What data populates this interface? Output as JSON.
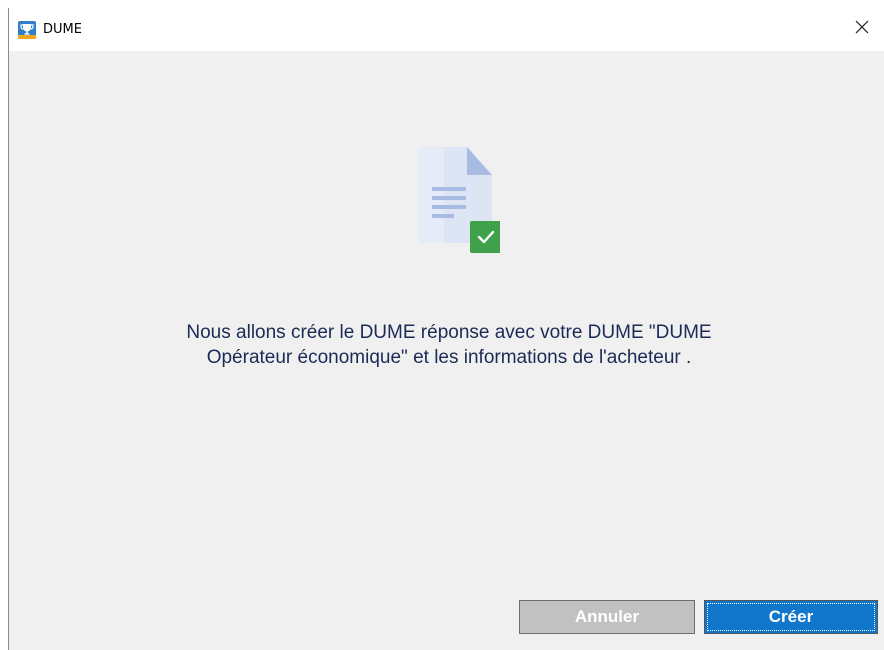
{
  "window": {
    "title": "DUME",
    "app_icon": "trophy-icon",
    "close_icon": "close-icon"
  },
  "content": {
    "illustration": "document-check-icon",
    "message": "Nous allons créer le DUME réponse avec votre DUME \"DUME Opérateur économique\" et les informations de l'acheteur ."
  },
  "actions": {
    "cancel_label": "Annuler",
    "create_label": "Créer"
  },
  "colors": {
    "primary": "#1177cc",
    "disabled": "#c1c1c1",
    "success": "#3fa14a",
    "text": "#1b2b55"
  }
}
